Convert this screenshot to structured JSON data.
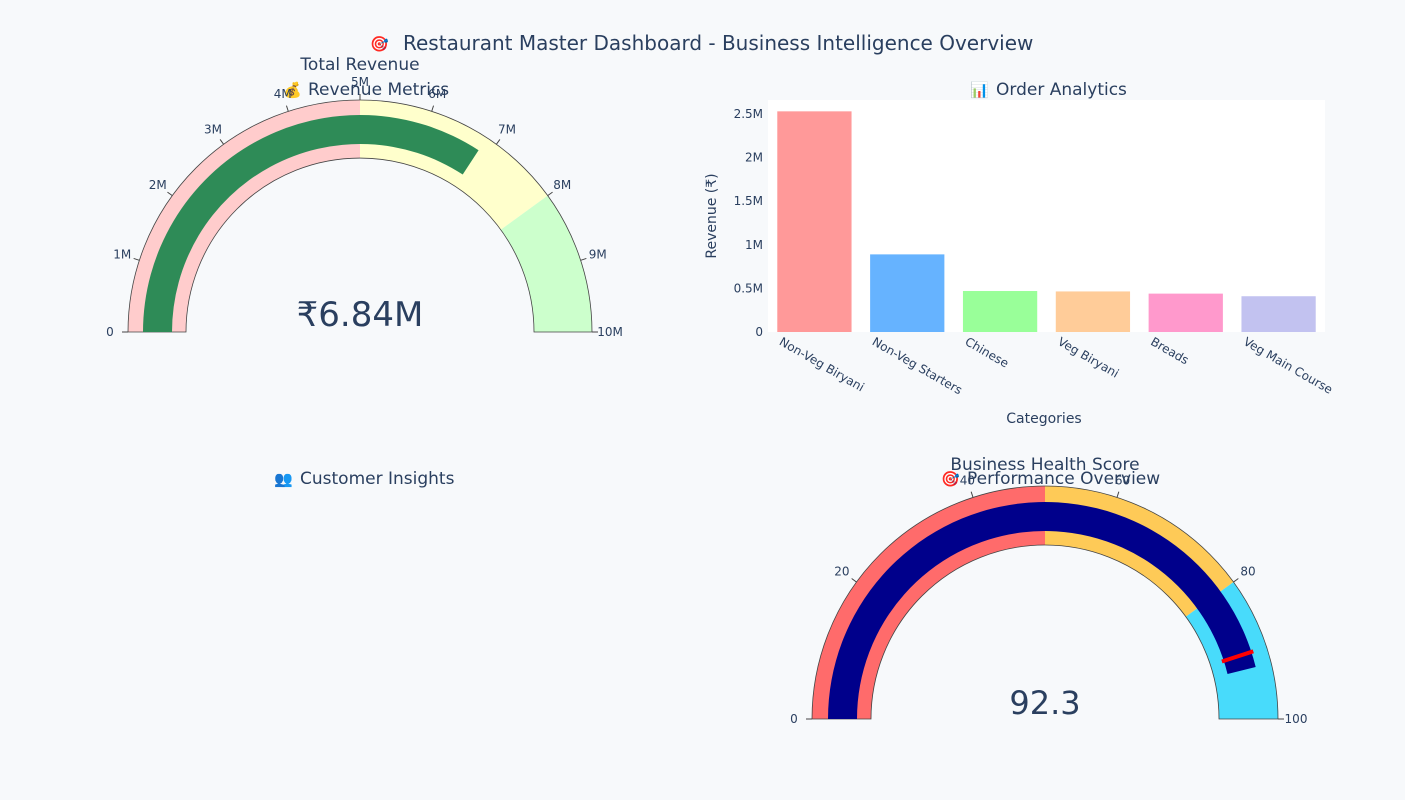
{
  "dashboard": {
    "title_icon": "target-icon",
    "title": "Restaurant Master Dashboard - Business Intelligence Overview"
  },
  "panels": {
    "revenue_metrics": {
      "icon": "money-bag-icon",
      "title": "Revenue Metrics"
    },
    "order_analytics": {
      "icon": "bar-chart-icon",
      "title": "Order Analytics"
    },
    "customer_insights": {
      "icon": "people-icon",
      "title": "Customer Insights"
    },
    "performance_overview": {
      "icon": "target-icon",
      "title": "Performance Overview"
    }
  },
  "colors": {
    "background": "#f7f9fb",
    "revenue_bar": "#2e8b57",
    "revenue_band_low": "#ffcccc",
    "revenue_band_mid": "#ffffcc",
    "revenue_band_high": "#ccffcc",
    "health_bar": "#00008b",
    "health_band_low": "#ff6b6b",
    "health_band_mid": "#feca57",
    "health_band_high": "#48dbfb",
    "threshold": "#ff0000"
  },
  "chart_data": [
    {
      "type": "gauge",
      "title": "Total Revenue",
      "value": 6840000,
      "value_text": "₹6.84M",
      "range": [
        0,
        10000000
      ],
      "ticks": [
        {
          "v": 0,
          "label": "0"
        },
        {
          "v": 1000000,
          "label": "1M"
        },
        {
          "v": 2000000,
          "label": "2M"
        },
        {
          "v": 3000000,
          "label": "3M"
        },
        {
          "v": 4000000,
          "label": "4M"
        },
        {
          "v": 5000000,
          "label": "5M"
        },
        {
          "v": 6000000,
          "label": "6M"
        },
        {
          "v": 7000000,
          "label": "7M"
        },
        {
          "v": 8000000,
          "label": "8M"
        },
        {
          "v": 9000000,
          "label": "9M"
        },
        {
          "v": 10000000,
          "label": "10M"
        }
      ],
      "steps": [
        {
          "range": [
            0,
            5000000
          ],
          "color": "#ffcccc"
        },
        {
          "range": [
            5000000,
            8000000
          ],
          "color": "#ffffcc"
        },
        {
          "range": [
            8000000,
            10000000
          ],
          "color": "#ccffcc"
        }
      ]
    },
    {
      "type": "bar",
      "title": "Order Analytics",
      "categories": [
        "Non-Veg Biryani",
        "Non-Veg Starters",
        "Chinese",
        "Veg Biryani",
        "Breads",
        "Veg Main Course"
      ],
      "values": [
        2530000,
        890000,
        470000,
        465000,
        440000,
        410000
      ],
      "colors": [
        "#ff9999",
        "#66b3ff",
        "#99ff99",
        "#ffcc99",
        "#ff99cc",
        "#c2c2f0"
      ],
      "xlabel": "Categories",
      "ylabel": "Revenue (₹)",
      "ylim": [
        0,
        2660000
      ],
      "yticks": [
        {
          "v": 0,
          "label": "0"
        },
        {
          "v": 500000,
          "label": "0.5M"
        },
        {
          "v": 1000000,
          "label": "1M"
        },
        {
          "v": 1500000,
          "label": "1.5M"
        },
        {
          "v": 2000000,
          "label": "2M"
        },
        {
          "v": 2500000,
          "label": "2.5M"
        }
      ],
      "grid": false
    },
    {
      "type": "gauge",
      "title": "Business Health Score",
      "value": 92.3,
      "value_text": "92.3",
      "range": [
        0,
        100
      ],
      "threshold": 90,
      "ticks": [
        {
          "v": 0,
          "label": "0"
        },
        {
          "v": 20,
          "label": "20"
        },
        {
          "v": 40,
          "label": "40"
        },
        {
          "v": 60,
          "label": "60"
        },
        {
          "v": 80,
          "label": "80"
        },
        {
          "v": 100,
          "label": "100"
        }
      ],
      "steps": [
        {
          "range": [
            0,
            50
          ],
          "color": "#ff6b6b"
        },
        {
          "range": [
            50,
            80
          ],
          "color": "#feca57"
        },
        {
          "range": [
            80,
            100
          ],
          "color": "#48dbfb"
        }
      ]
    }
  ]
}
